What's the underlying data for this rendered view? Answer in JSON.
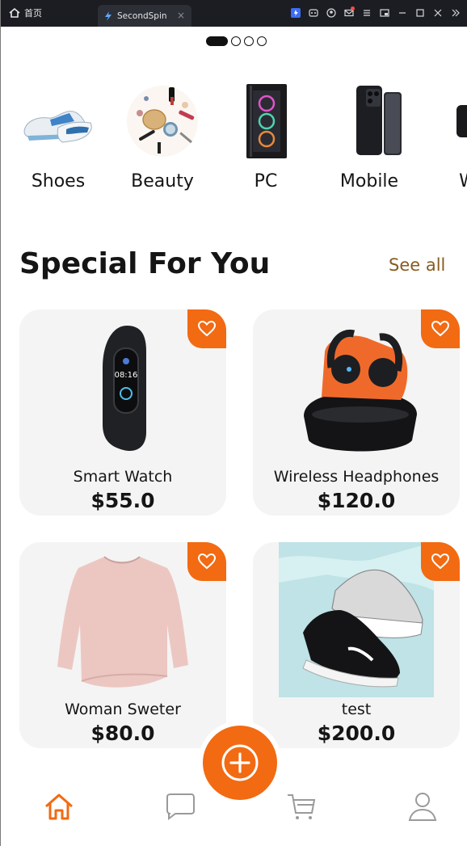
{
  "browser": {
    "home_label": "首页",
    "tab_title": "SecondSpin",
    "tab_close": "×",
    "tools": [
      "gift-icon",
      "game-icon",
      "account-icon",
      "mail-icon",
      "menu-icon",
      "pip-icon",
      "minimize-icon",
      "maximize-icon",
      "close-icon",
      "more-icon"
    ]
  },
  "pager": {
    "count": 4,
    "active": 0
  },
  "categories": [
    {
      "label": "Shoes"
    },
    {
      "label": "Beauty"
    },
    {
      "label": "PC"
    },
    {
      "label": "Mobile"
    },
    {
      "label": "W"
    }
  ],
  "section": {
    "title": "Special For You",
    "see_all": "See all"
  },
  "products": [
    {
      "name": "Smart Watch",
      "price": "$55.0"
    },
    {
      "name": "Wireless Headphones",
      "price": "$120.0"
    },
    {
      "name": "Woman Sweter",
      "price": "$80.0"
    },
    {
      "name": "test",
      "price": "$200.0"
    }
  ],
  "nav": {
    "items": [
      "home-icon",
      "chat-icon",
      "cart-icon",
      "profile-icon"
    ],
    "active": "home-icon"
  },
  "colors": {
    "accent": "#f26a12",
    "card_bg": "#f4f4f4",
    "see_all": "#8a5a1f",
    "nav_inactive": "#9a9a9a"
  }
}
